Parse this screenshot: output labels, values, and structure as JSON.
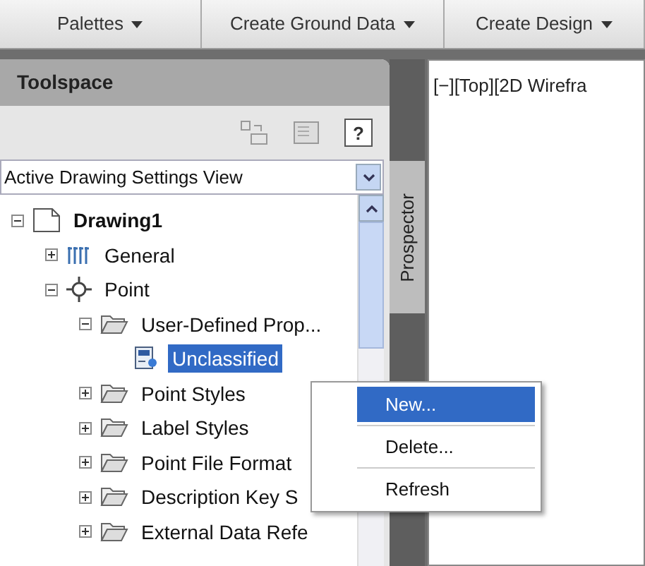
{
  "menu_bar": [
    {
      "label": "Palettes"
    },
    {
      "label": "Create Ground Data"
    },
    {
      "label": "Create Design"
    }
  ],
  "toolspace": {
    "title": "Toolspace",
    "help": "?",
    "view_select": {
      "value": "Active Drawing Settings View"
    },
    "side_tab": "Prospector",
    "tree": [
      {
        "label": "Drawing1",
        "kind": "drawing",
        "expanded": true,
        "selected": false,
        "children": [
          {
            "label": "General",
            "kind": "tools",
            "expanded": false,
            "selected": false
          },
          {
            "label": "Point",
            "kind": "point",
            "expanded": true,
            "selected": false,
            "children": [
              {
                "label": "User-Defined Prop...",
                "kind": "folder",
                "expanded": true,
                "selected": false,
                "children": [
                  {
                    "label": "Unclassified",
                    "kind": "property",
                    "selected": true
                  }
                ]
              },
              {
                "label": "Point Styles",
                "kind": "folder",
                "expanded": false,
                "selected": false
              },
              {
                "label": "Label Styles",
                "kind": "folder",
                "expanded": false,
                "selected": false
              },
              {
                "label": "Point File Format",
                "kind": "folder",
                "expanded": false,
                "selected": false
              },
              {
                "label": "Description Key S",
                "kind": "folder",
                "expanded": false,
                "selected": false
              },
              {
                "label": "External Data Refe",
                "kind": "folder",
                "expanded": false,
                "selected": false
              }
            ]
          }
        ]
      }
    ]
  },
  "viewport": {
    "label": "[−][Top][2D Wirefra"
  },
  "context_menu": [
    {
      "label": "New...",
      "selected": true
    },
    {
      "label": "Delete...",
      "selected": false
    },
    {
      "label": "Refresh",
      "selected": false
    }
  ]
}
